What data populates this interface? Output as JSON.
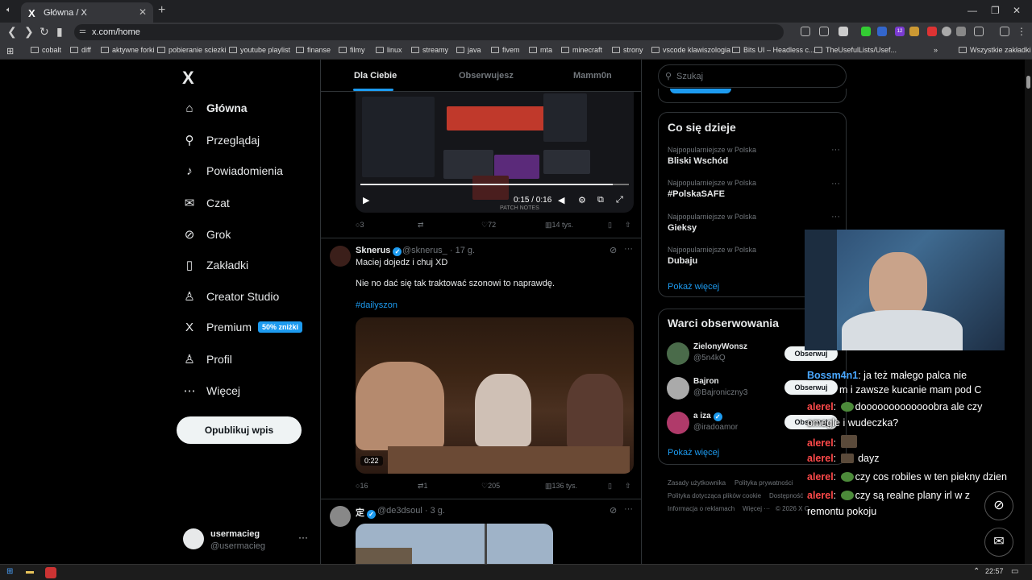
{
  "browser": {
    "tab_title": "Główna / X",
    "tab_favicon": "X",
    "address": "x.com/home",
    "bookmarks": [
      "cobalt",
      "diff",
      "aktywne forki",
      "pobieranie sciezki",
      "youtube playlist",
      "finanse",
      "filmy",
      "linux",
      "streamy",
      "java",
      "fivem",
      "mta",
      "minecraft",
      "strony",
      "vscode klawiszologia",
      "Bits UI – Headless c...",
      "TheUsefulLists/Usef..."
    ],
    "all_bookmarks": "Wszystkie zakładki",
    "ext_badge": "12"
  },
  "sidebar": {
    "logo": "X",
    "items": [
      {
        "label": "Główna",
        "icon": "⌂"
      },
      {
        "label": "Przeglądaj",
        "icon": "⚲"
      },
      {
        "label": "Powiadomienia",
        "icon": "♪"
      },
      {
        "label": "Czat",
        "icon": "✉"
      },
      {
        "label": "Grok",
        "icon": "⊘"
      },
      {
        "label": "Zakładki",
        "icon": "▯"
      },
      {
        "label": "Creator Studio",
        "icon": "♙"
      },
      {
        "label": "Premium",
        "icon": "X"
      },
      {
        "label": "Profil",
        "icon": "♙"
      },
      {
        "label": "Więcej",
        "icon": "⋯"
      }
    ],
    "premium_badge": "50% zniżki",
    "post_button": "Opublikuj wpis",
    "account": {
      "name": "usermacieg",
      "handle": "@usermacieg",
      "more": "···"
    }
  },
  "feed": {
    "tabs": [
      "Dla Ciebie",
      "Obserwujesz",
      "Mamm0n"
    ],
    "post1": {
      "video_time": "0:15 / 0:16",
      "video_progress": 0.94,
      "media_caption": "PATCH NOTES",
      "stats": {
        "replies": "3",
        "reposts": "",
        "likes": "72",
        "views": "14 tys."
      }
    },
    "post2": {
      "name": "Sknerus",
      "handle": "@sknerus_",
      "time": "· 17 g.",
      "line1": "Maciej dojedz i chuj XD",
      "line2": "Nie no dać się tak traktować szonowi to naprawdę.",
      "hashtag": "#dailyszon",
      "video_duration": "0:22",
      "stats": {
        "replies": "16",
        "reposts": "1",
        "likes": "205",
        "views": "136 tys."
      }
    },
    "post3": {
      "name": "定",
      "handle": "@de3dsoul",
      "time": "· 3 g."
    }
  },
  "right": {
    "search_placeholder": "Szukaj",
    "trends_title": "Co się dzieje",
    "trends": [
      {
        "category": "Najpopularniejsze w Polska",
        "name": "Bliski Wschód"
      },
      {
        "category": "Najpopularniejsze w Polska",
        "name": "#PolskaSAFE"
      },
      {
        "category": "Najpopularniejsze w Polska",
        "name": "Gieksy"
      },
      {
        "category": "Najpopularniejsze w Polska",
        "name": "Dubaju"
      }
    ],
    "show_more": "Pokaż więcej",
    "who_title": "Warci obserwowania",
    "who": [
      {
        "name": "ZielonyWonsz",
        "handle": "@5n4kQ",
        "button": "Obserwuj"
      },
      {
        "name": "Bajron",
        "handle": "@Bajroniczny3",
        "button": "Obserwuj"
      },
      {
        "name": "a iza",
        "handle": "@iradoamor",
        "button": "Obserwuj"
      }
    ],
    "footer": [
      "Zasady użytkownika",
      "Polityka prywatności",
      "Polityka dotycząca plików cookie",
      "Dostępność",
      "Informacja o reklamach",
      "Więcej ···",
      "© 2026 X C..."
    ]
  },
  "stream_chat": [
    {
      "user": "Bossm4n1",
      "text": ": ja też małego palca nie"
    },
    {
      "user": "",
      "text": "m i zawsze kucanie mam pod C"
    },
    {
      "user": "alerel",
      "text": "dooooooooooooobra ale czy"
    },
    {
      "user": "",
      "text": "omegle i wudeczka?"
    },
    {
      "user": "alerel",
      "text": ":"
    },
    {
      "user": "alerel",
      "text": "dayz"
    },
    {
      "user": "alerel",
      "text": "czy cos robiles w ten piekny dzien"
    },
    {
      "user": "alerel",
      "text": "czy są realne plany irl w z"
    },
    {
      "user": "",
      "text": "remontu pokoju"
    }
  ],
  "taskbar": {
    "time": "22:57"
  },
  "colors": {
    "accent": "#1d9bf0",
    "bg": "#000000",
    "border": "#2f3336",
    "muted": "#71767b"
  }
}
